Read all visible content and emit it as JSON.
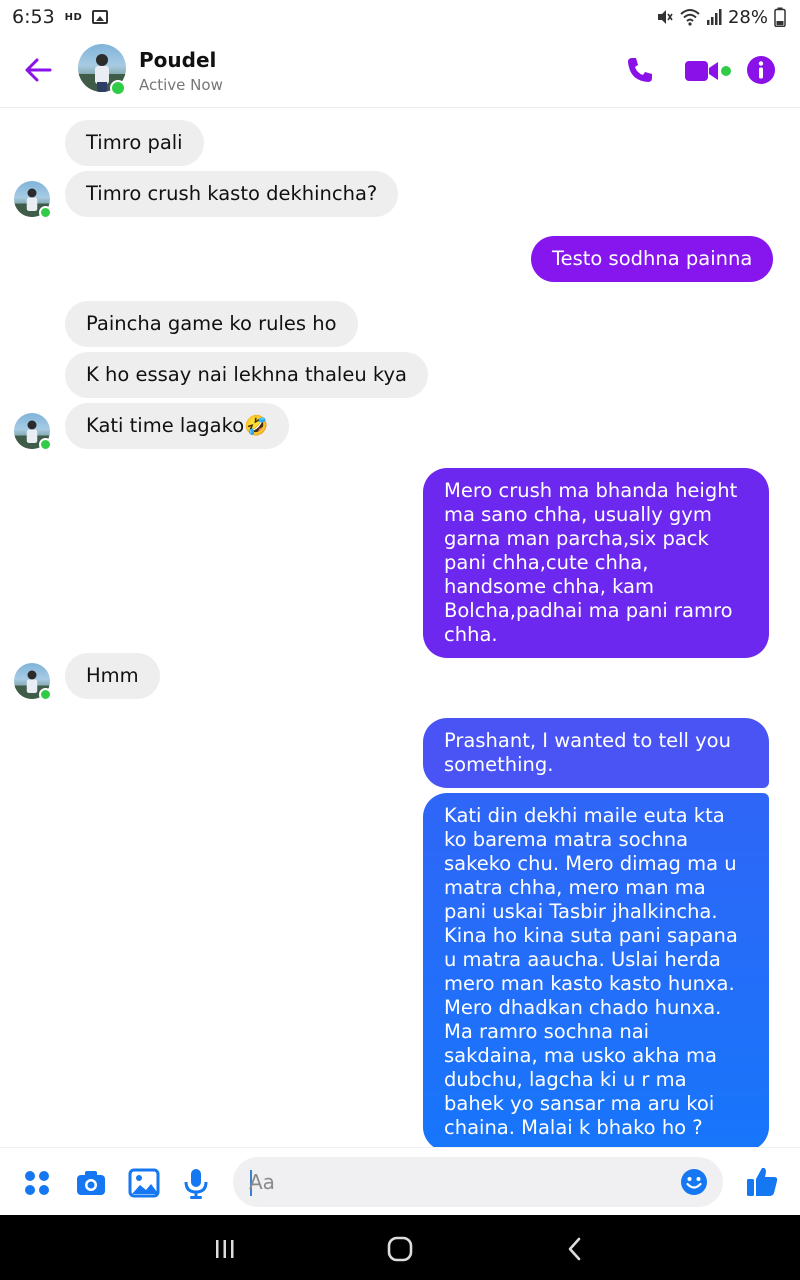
{
  "status_bar": {
    "time": "6:53",
    "hd_label": "HD",
    "battery": "28%",
    "icons": [
      "hd-icon",
      "gallery-notification-icon",
      "mute-icon",
      "wifi-icon",
      "signal-icon"
    ]
  },
  "header": {
    "name": "Poudel",
    "status": "Active Now",
    "online": true,
    "icons": [
      "back-arrow-icon",
      "phone-icon",
      "video-camera-icon",
      "info-icon"
    ]
  },
  "colors": {
    "accent": "#8a12e8",
    "received_bubble": "#eeeeef",
    "online": "#31cc46",
    "sent_top": "#7d1ff2",
    "sent_bottom": "#1a74fb",
    "action_blue": "#1577f2"
  },
  "messages": [
    {
      "sender": "them",
      "text": "Timro pali"
    },
    {
      "sender": "them",
      "text": "Timro crush kasto dekhincha?"
    },
    {
      "sender": "me",
      "text": "Testo sodhna painna"
    },
    {
      "sender": "them",
      "text": "Paincha game ko rules ho"
    },
    {
      "sender": "them",
      "text": "K ho essay nai lekhna thaleu kya"
    },
    {
      "sender": "them",
      "text": "Kati time lagako🤣"
    },
    {
      "sender": "me",
      "text": "Mero crush ma bhanda height ma sano chha, usually gym garna man parcha,six pack pani chha,cute chha, handsome chha, kam Bolcha,padhai ma pani ramro chha."
    },
    {
      "sender": "them",
      "text": "Hmm"
    },
    {
      "sender": "me",
      "text": "Prashant, I wanted to tell you something."
    },
    {
      "sender": "me",
      "text": "Kati din dekhi maile euta kta ko barema matra sochna sakeko chu. Mero dimag ma u matra chha, mero man ma pani uskai Tasbir jhalkincha. Kina ho kina suta pani sapana u matra aaucha. Uslai herda mero man kasto kasto hunxa. Mero dhadkan chado hunxa. Ma ramro sochna nai sakdaina, ma usko akha ma dubchu, lagcha ki u r ma bahek yo sansar ma aru koi chaina. Malai k bhako ho ?"
    }
  ],
  "composer": {
    "placeholder": "Aa",
    "value": "",
    "icons": [
      "apps-grid-icon",
      "camera-icon",
      "gallery-icon",
      "microphone-icon",
      "emoji-icon",
      "thumbs-up-icon"
    ]
  },
  "nav_bar": {
    "icons": [
      "recent-apps-icon",
      "home-icon",
      "back-icon"
    ]
  }
}
